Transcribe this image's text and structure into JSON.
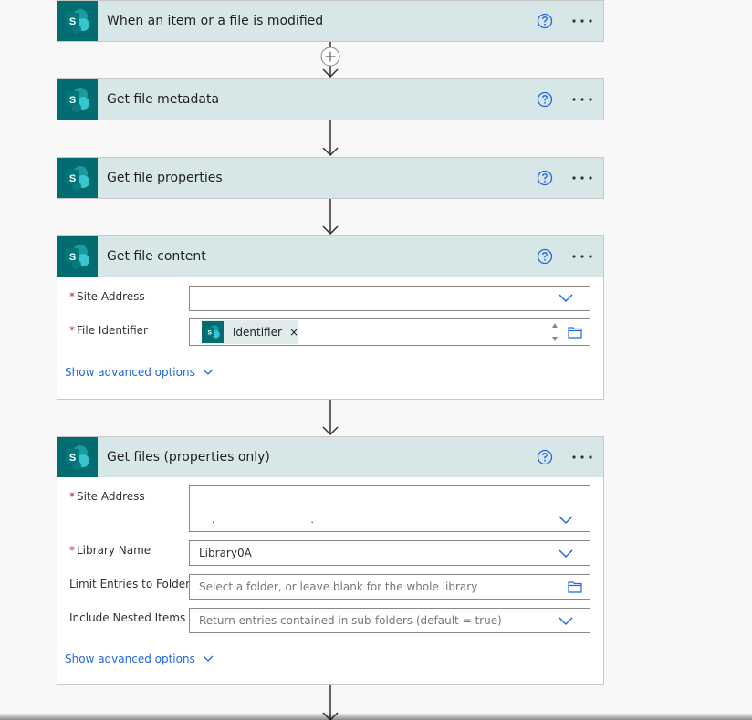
{
  "steps": [
    {
      "title": "When an item or a file is modified"
    },
    {
      "title": "Get file metadata"
    },
    {
      "title": "Get file properties"
    },
    {
      "title": "Get file content",
      "fields": {
        "site_address_label": "Site Address",
        "file_identifier_label": "File Identifier",
        "file_identifier_token": "Identifier",
        "token_remove": "×"
      },
      "advanced": "Show advanced options"
    },
    {
      "title": "Get files (properties only)",
      "fields": {
        "site_address_label": "Site Address",
        "site_address_value": ".                              .",
        "library_name_label": "Library Name",
        "library_name_value": "Library0A",
        "limit_label": "Limit Entries to Folder",
        "limit_placeholder": "Select a folder, or leave blank for the whole library",
        "nested_label": "Include Nested Items",
        "nested_placeholder": "Return entries contained in sub-folders (default = true)"
      },
      "advanced": "Show advanced options"
    }
  ],
  "icons": {
    "connector": "sharepoint-icon",
    "help": "help-icon",
    "more": "more-options-icon"
  },
  "required_mark": "*",
  "sharepoint_letter": "S",
  "colors": {
    "header_bg": "#d7e7e8",
    "sharepoint": "#036c70",
    "link": "#2266e3",
    "required": "#a4262c"
  }
}
